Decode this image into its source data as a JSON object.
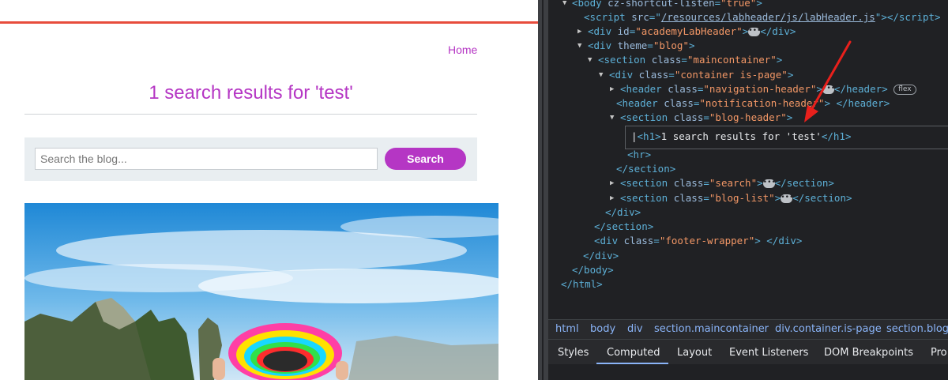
{
  "page": {
    "nav_home": "Home",
    "title": "1 search results for 'test'",
    "search_placeholder": "Search the blog...",
    "search_button": "Search"
  },
  "devtools": {
    "lines": {
      "body_attr": "cz-shortcut-listen",
      "body_val": "\"true\"",
      "script_src": "/resources/labheader/js/labHeader.js",
      "div_id": "\"academyLabHeader\"",
      "theme_val": "\"blog\"",
      "maincontainer_val": "\"maincontainer\"",
      "container_val": "\"container is-page\"",
      "nav_header_val": "\"navigation-header\"",
      "notif_header_val": "\"notification-header\"",
      "blog_header_val": "\"blog-header\"",
      "h1_text": "1 search results for 'test'",
      "search_val": "\"search\"",
      "bloglist_val": "\"blog-list\"",
      "footer_val": "\"footer-wrapper\"",
      "flex_badge": "flex"
    },
    "breadcrumbs": [
      "html",
      "body",
      "div",
      "section.maincontainer",
      "div.container.is-page",
      "section.blog-"
    ],
    "tabs": [
      "Styles",
      "Computed",
      "Layout",
      "Event Listeners",
      "DOM Breakpoints",
      "Pro"
    ],
    "active_tab": "Computed"
  },
  "colors": {
    "accent": "#b536c4",
    "top_rule": "#e74c3c",
    "annotation_arrow": "#e8201c",
    "devtools_bg": "#202124"
  }
}
